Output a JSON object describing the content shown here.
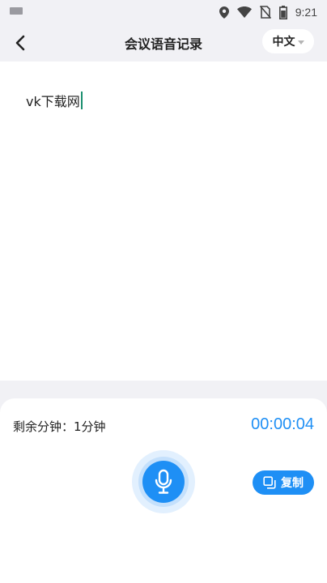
{
  "status_bar": {
    "time": "9:21",
    "icons": [
      "keyboard-icon",
      "location-icon",
      "wifi-icon",
      "no-sim-icon",
      "battery-icon"
    ]
  },
  "header": {
    "title": "会议语音记录",
    "back_icon": "chevron-left-icon",
    "language": "中文"
  },
  "transcript": {
    "text": "vk下载网"
  },
  "panel": {
    "remaining_label": "剩余分钟：1分钟",
    "timer": "00:00:04",
    "copy_label": "复制",
    "mic_icon": "microphone-icon"
  },
  "colors": {
    "accent": "#1e8ff5",
    "cursor": "#1a8f6f",
    "background": "#f1f1f5"
  }
}
